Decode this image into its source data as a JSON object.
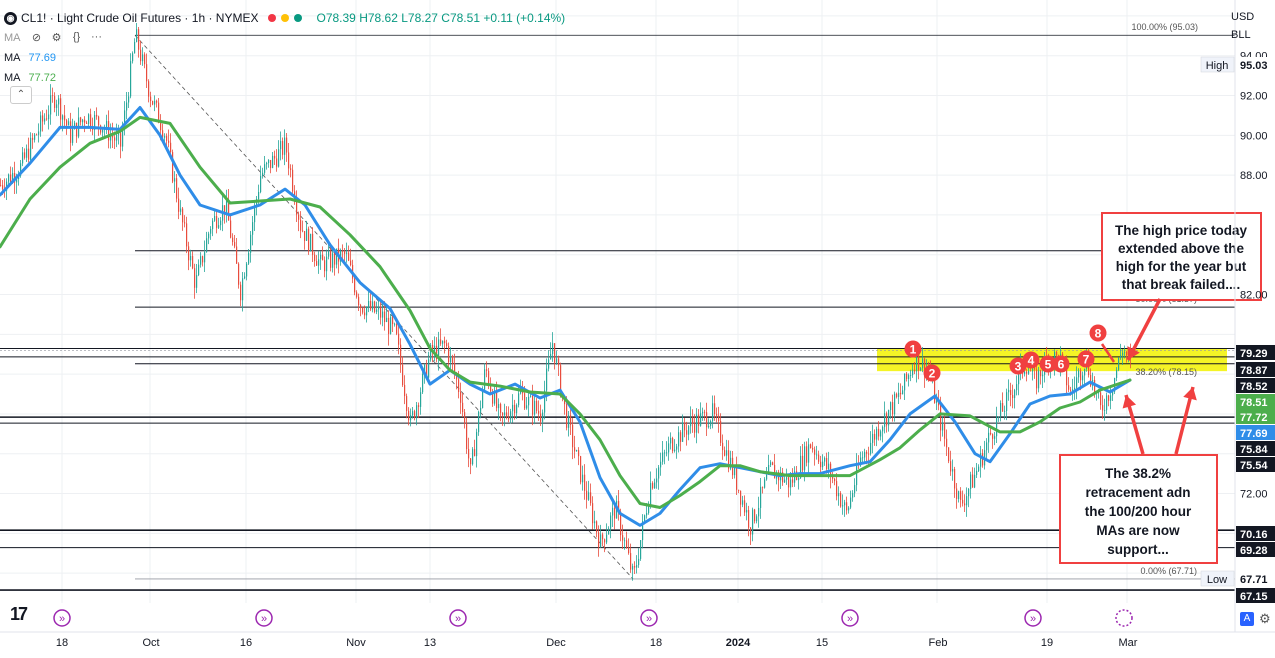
{
  "header": {
    "symbol": "CL1!",
    "title": "Light Crude Oil Futures",
    "interval": "1h",
    "exchange": "NYMEX",
    "ohlc": {
      "o": "O78.39",
      "h": "H78.62",
      "l": "L78.27",
      "c": "C78.51",
      "chg": "+0.11 (+0.14%)"
    },
    "ma_rows": [
      {
        "label": "MA",
        "value": "77.69",
        "color": "#2196f3"
      },
      {
        "label": "MA",
        "value": "77.72",
        "color": "#4caf50"
      }
    ],
    "toolbar_icon_label": "MA"
  },
  "top_right": {
    "currency": "USD",
    "unit": "BLL"
  },
  "icons": [
    "eye-off-icon",
    "settings-icon",
    "braces-icon",
    "more-icon",
    "collapse-icon",
    "tradingview-logo-icon",
    "gear-icon"
  ],
  "colors": {
    "ma100": "#2f8de8",
    "ma200": "#4cae4c",
    "up": "#26a69a",
    "down": "#e84c3d",
    "zone": "#f2f200",
    "annotation": "#f04040"
  },
  "chart_data": {
    "type": "candlestick",
    "ylim": [
      66.5,
      96.8
    ],
    "y_ticks": [
      "94.00",
      "92.00",
      "90.00",
      "88.00",
      "72.00",
      "82.00"
    ],
    "y_tick_values": [
      94,
      92,
      90,
      88,
      72,
      82
    ],
    "x_tick_labels": [
      "18",
      "Oct",
      "16",
      "Nov",
      "13",
      "Dec",
      "18",
      "2024",
      "15",
      "Feb",
      "19",
      "Mar"
    ],
    "price_labels": [
      {
        "text": "95.03",
        "value": 95.03,
        "style": "plain",
        "tag": "High"
      },
      {
        "text": "79.29",
        "value": 79.29,
        "style": "dark"
      },
      {
        "text": "78.87",
        "value": 78.87,
        "style": "dark"
      },
      {
        "text": "78.52",
        "value": 78.52,
        "style": "dark"
      },
      {
        "text": "78.51",
        "value": 78.51,
        "style": "green"
      },
      {
        "text": "77.72",
        "value": 77.72,
        "style": "green"
      },
      {
        "text": "77.69",
        "value": 77.69,
        "style": "blue"
      },
      {
        "text": "75.84",
        "value": 75.84,
        "style": "dark"
      },
      {
        "text": "75.54",
        "value": 75.54,
        "style": "dark"
      },
      {
        "text": "70.16",
        "value": 70.16,
        "style": "dark"
      },
      {
        "text": "69.28",
        "value": 69.28,
        "style": "dark"
      },
      {
        "text": "67.71",
        "value": 67.71,
        "style": "plain",
        "tag": "Low"
      },
      {
        "text": "67.15",
        "value": 67.15,
        "style": "dark"
      }
    ],
    "fib_levels": [
      {
        "label": "100.00% (95.03)",
        "value": 95.03
      },
      {
        "label": "50.00% (81.37)",
        "value": 81.37
      },
      {
        "label": "38.20% (78.15)",
        "value": 78.15
      },
      {
        "label": "0.00% (67.71)",
        "value": 67.71
      }
    ],
    "horizontal_lines": [
      84.2,
      81.37,
      79.29,
      78.87,
      78.52,
      75.84,
      75.54,
      70.16,
      69.28,
      67.15
    ],
    "price_path": [
      [
        0,
        87.5
      ],
      [
        20,
        88.4
      ],
      [
        40,
        90.5
      ],
      [
        55,
        92
      ],
      [
        70,
        90
      ],
      [
        85,
        91
      ],
      [
        100,
        90.6
      ],
      [
        120,
        89.5
      ],
      [
        135,
        95.03
      ],
      [
        150,
        92
      ],
      [
        165,
        90
      ],
      [
        180,
        86
      ],
      [
        195,
        82.5
      ],
      [
        210,
        85.5
      ],
      [
        225,
        86.5
      ],
      [
        240,
        82.2
      ],
      [
        260,
        88
      ],
      [
        285,
        89.5
      ],
      [
        300,
        85.5
      ],
      [
        320,
        83.5
      ],
      [
        345,
        84
      ],
      [
        360,
        81.5
      ],
      [
        380,
        81
      ],
      [
        395,
        80
      ],
      [
        410,
        75.5
      ],
      [
        430,
        79
      ],
      [
        445,
        79.5
      ],
      [
        460,
        77
      ],
      [
        470,
        73
      ],
      [
        485,
        78.3
      ],
      [
        500,
        75.6
      ],
      [
        520,
        77
      ],
      [
        540,
        76
      ],
      [
        552,
        79.6
      ],
      [
        565,
        76
      ],
      [
        580,
        73
      ],
      [
        600,
        69.5
      ],
      [
        615,
        71.3
      ],
      [
        633,
        67.71
      ],
      [
        650,
        72.5
      ],
      [
        670,
        74.5
      ],
      [
        690,
        75.5
      ],
      [
        712,
        76
      ],
      [
        730,
        73.5
      ],
      [
        750,
        70.4
      ],
      [
        770,
        73.2
      ],
      [
        790,
        72.5
      ],
      [
        810,
        74.5
      ],
      [
        830,
        73
      ],
      [
        846,
        71
      ],
      [
        860,
        73.7
      ],
      [
        880,
        75.5
      ],
      [
        900,
        77
      ],
      [
        915,
        78.8
      ],
      [
        928,
        78.2
      ],
      [
        945,
        74.5
      ],
      [
        960,
        71.4
      ],
      [
        975,
        73
      ],
      [
        990,
        75
      ],
      [
        1010,
        77
      ],
      [
        1025,
        78.6
      ],
      [
        1035,
        77.6
      ],
      [
        1048,
        78.9
      ],
      [
        1060,
        78.7
      ],
      [
        1070,
        77
      ],
      [
        1085,
        78.8
      ],
      [
        1100,
        76.2
      ],
      [
        1112,
        77.5
      ],
      [
        1122,
        79.3
      ],
      [
        1130,
        78.5
      ]
    ],
    "series": [
      {
        "name": "",
        "color": "#2f8de8",
        "values": [
          [
            0,
            87
          ],
          [
            30,
            88.6
          ],
          [
            60,
            90.4
          ],
          [
            90,
            90.4
          ],
          [
            120,
            90.3
          ],
          [
            140,
            91.4
          ],
          [
            160,
            90
          ],
          [
            180,
            88
          ],
          [
            200,
            86.5
          ],
          [
            230,
            86
          ],
          [
            260,
            86.5
          ],
          [
            285,
            87.3
          ],
          [
            305,
            86.5
          ],
          [
            330,
            84.5
          ],
          [
            360,
            82.6
          ],
          [
            390,
            81.3
          ],
          [
            410,
            79.5
          ],
          [
            430,
            77.5
          ],
          [
            450,
            78.2
          ],
          [
            470,
            77.5
          ],
          [
            490,
            77
          ],
          [
            515,
            77.5
          ],
          [
            540,
            76.8
          ],
          [
            560,
            77.2
          ],
          [
            580,
            75.6
          ],
          [
            600,
            72.8
          ],
          [
            620,
            71
          ],
          [
            640,
            70.4
          ],
          [
            660,
            71
          ],
          [
            680,
            72.2
          ],
          [
            700,
            73.3
          ],
          [
            720,
            73.5
          ],
          [
            740,
            73.3
          ],
          [
            760,
            73.1
          ],
          [
            780,
            72.9
          ],
          [
            800,
            73
          ],
          [
            820,
            73
          ],
          [
            850,
            73.4
          ],
          [
            870,
            73.6
          ],
          [
            890,
            74.7
          ],
          [
            910,
            76
          ],
          [
            935,
            76.9
          ],
          [
            955,
            75.6
          ],
          [
            975,
            74
          ],
          [
            990,
            73.6
          ],
          [
            1010,
            75
          ],
          [
            1030,
            76.5
          ],
          [
            1050,
            76.9
          ],
          [
            1070,
            77
          ],
          [
            1090,
            77.6
          ],
          [
            1110,
            77.1
          ],
          [
            1130,
            77.7
          ]
        ]
      },
      {
        "name": "",
        "color": "#4cae4c",
        "values": [
          [
            0,
            84.4
          ],
          [
            30,
            86.8
          ],
          [
            60,
            88.4
          ],
          [
            90,
            89.6
          ],
          [
            120,
            90.2
          ],
          [
            140,
            90.9
          ],
          [
            170,
            90.6
          ],
          [
            200,
            88.4
          ],
          [
            230,
            86.6
          ],
          [
            260,
            86.7
          ],
          [
            290,
            86.8
          ],
          [
            320,
            86.4
          ],
          [
            350,
            85
          ],
          [
            380,
            83.4
          ],
          [
            410,
            81.2
          ],
          [
            430,
            79.3
          ],
          [
            450,
            78.2
          ],
          [
            470,
            77.6
          ],
          [
            500,
            77.4
          ],
          [
            530,
            77.1
          ],
          [
            560,
            77
          ],
          [
            580,
            76
          ],
          [
            600,
            74.7
          ],
          [
            620,
            72.9
          ],
          [
            640,
            71.5
          ],
          [
            660,
            71.3
          ],
          [
            680,
            71.9
          ],
          [
            700,
            72.6
          ],
          [
            720,
            73.4
          ],
          [
            740,
            73.4
          ],
          [
            760,
            73.1
          ],
          [
            790,
            72.9
          ],
          [
            820,
            72.9
          ],
          [
            850,
            72.9
          ],
          [
            880,
            73.7
          ],
          [
            900,
            74.3
          ],
          [
            920,
            75.2
          ],
          [
            940,
            76
          ],
          [
            970,
            75.9
          ],
          [
            1000,
            75.1
          ],
          [
            1020,
            75.1
          ],
          [
            1040,
            75.6
          ],
          [
            1060,
            76.3
          ],
          [
            1080,
            76.6
          ],
          [
            1100,
            77.2
          ],
          [
            1130,
            77.7
          ]
        ]
      }
    ],
    "annotations": [
      {
        "text": "1",
        "x": 913,
        "y": 349
      },
      {
        "text": "2",
        "x": 932,
        "y": 373
      },
      {
        "text": "3",
        "x": 1018,
        "y": 366
      },
      {
        "text": "4",
        "x": 1031,
        "y": 360
      },
      {
        "text": "5",
        "x": 1048,
        "y": 364
      },
      {
        "text": "6",
        "x": 1061,
        "y": 364
      },
      {
        "text": "7",
        "x": 1086,
        "y": 359
      },
      {
        "text": "8",
        "x": 1098,
        "y": 333
      }
    ],
    "callouts": [
      {
        "lines": [
          "The high price today",
          "extended above the",
          "high for the year but",
          "that break failed...."
        ]
      },
      {
        "lines": [
          "The 38.2%",
          "retracement adn",
          "the 100/200 hour",
          "MAs are now",
          "support..."
        ]
      }
    ]
  }
}
